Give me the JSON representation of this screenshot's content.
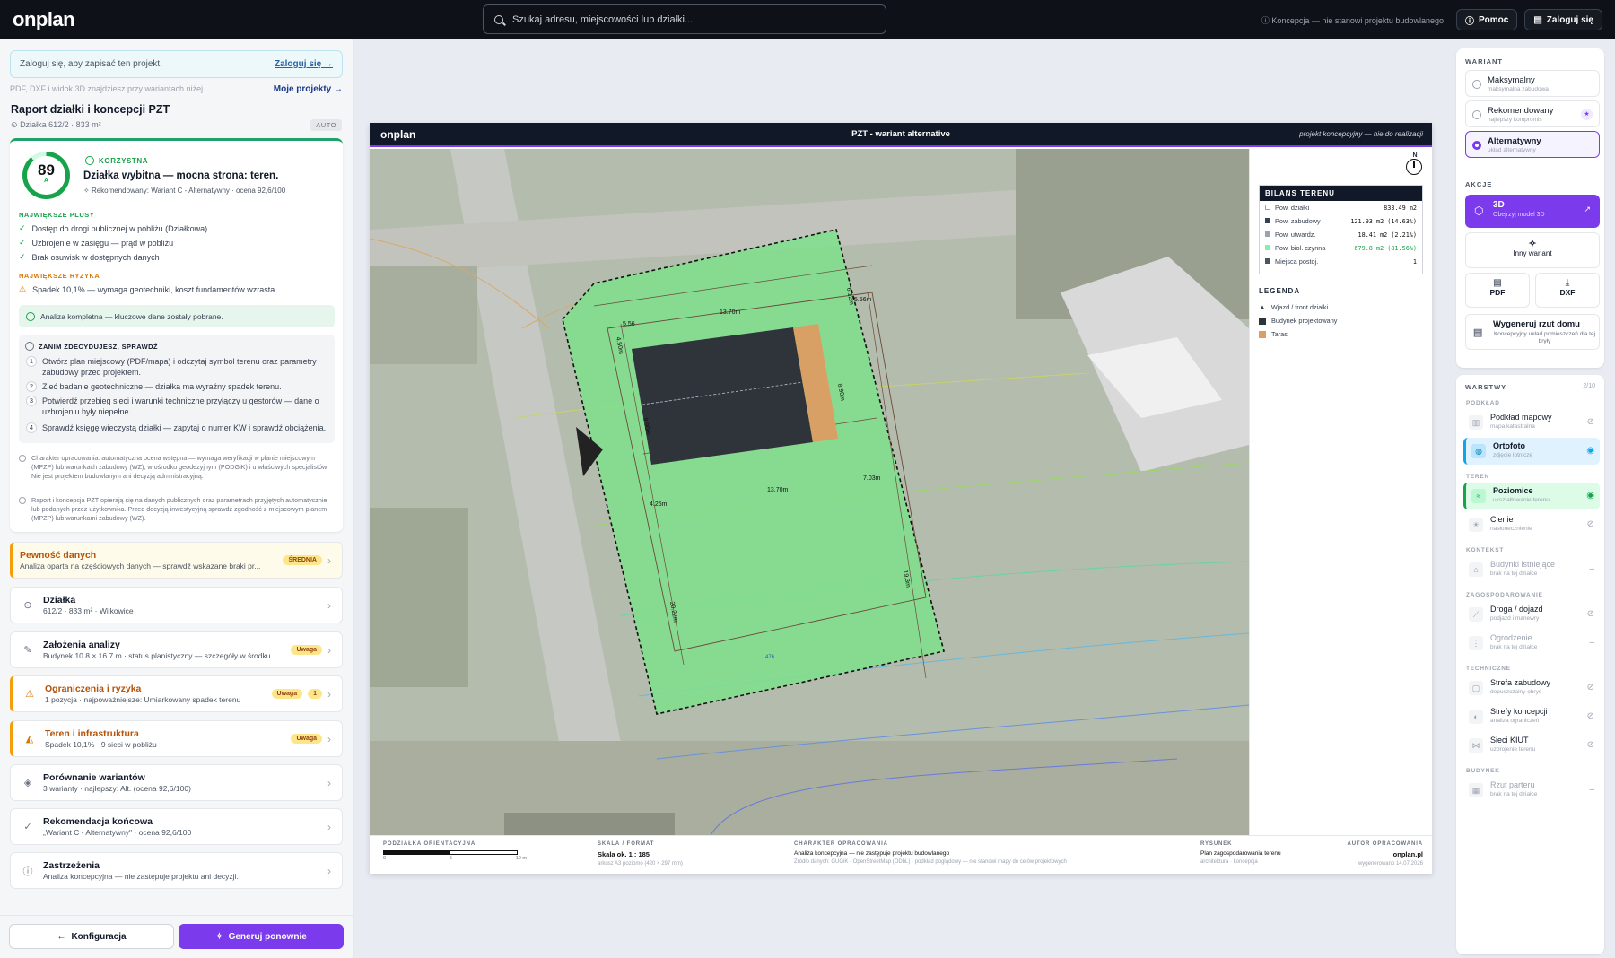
{
  "header": {
    "logo": "onplan",
    "search_placeholder": "Szukaj adresu, miejscowości lub działki...",
    "disclaimer": "Koncepcja — nie stanowi projektu budowlanego",
    "help": "Pomoc",
    "login": "Zaloguj się"
  },
  "left": {
    "login_hint": "Zaloguj się, aby zapisać ten projekt.",
    "login_link": "Zaloguj się →",
    "files_hint": "PDF, DXF i widok 3D znajdziesz przy wariantach niżej.",
    "my_projects": "Moje projekty →",
    "title": "Raport działki i koncepcji PZT",
    "plot": "Działka 612/2 · 833 m²",
    "auto": "AUTO",
    "score": "89",
    "grade": "A",
    "verdict": "KORZYSTNA",
    "headline": "Działka wybitna — mocna strona: teren.",
    "recommended": "Rekomendowany: Wariant C - Alternatywny · ocena 92,6/100",
    "plus_title": "NAJWIĘKSZE PLUSY",
    "plus": [
      "Dostęp do drogi publicznej w pobliżu (Działkowa)",
      "Uzbrojenie w zasięgu — prąd w pobliżu",
      "Brak osuwisk w dostępnych danych"
    ],
    "risk_title": "NAJWIĘKSZE RYZYKA",
    "risks": [
      "Spadek 10,1% — wymaga geotechniki, koszt fundamentów wzrasta"
    ],
    "analysis_ok": "Analiza kompletna — kluczowe dane zostały pobrane.",
    "check_title": "ZANIM ZDECYDUJESZ, SPRAWDŹ",
    "checks": [
      "Otwórz plan miejscowy (PDF/mapa) i odczytaj symbol terenu oraz parametry zabudowy przed projektem.",
      "Zleć badanie geotechniczne — działka ma wyraźny spadek terenu.",
      "Potwierdź przebieg sieci i warunki techniczne przyłączy u gestorów — dane o uzbrojeniu były niepełne.",
      "Sprawdź księgę wieczystą działki — zapytaj o numer KW i sprawdź obciążenia."
    ],
    "notes": [
      "Charakter opracowania: automatyczna ocena wstępna — wymaga weryfikacji w planie miejscowym (MPZP) lub warunkach zabudowy (WZ), w ośrodku geodezyjnym (PODGiK) i u właściwych specjalistów. Nie jest projektem budowlanym ani decyzją administracyjną.",
      "Raport i koncepcja PZT opierają się na danych publicznych oraz parametrach przyjętych automatycznie lub podanych przez użytkownika. Przed decyzją inwestycyjną sprawdź zgodność z miejscowym planem (MPZP) lub warunkami zabudowy (WZ)."
    ],
    "accordion": [
      {
        "t": "Pewność danych",
        "s": "Analiza oparta na częściowych danych — sprawdź wskazane braki pr...",
        "badge": "ŚREDNIA"
      },
      {
        "t": "Działka",
        "s": "612/2 · 833 m² · Wilkowice"
      },
      {
        "t": "Założenia analizy",
        "s": "Budynek 10.8 × 16.7 m · status planistyczny — szczegóły w środku",
        "badge": "Uwaga"
      },
      {
        "t": "Ograniczenia i ryzyka",
        "s": "1 pozycja · najpoważniejsze: Umiarkowany spadek terenu",
        "badge": "Uwaga",
        "count": "1"
      },
      {
        "t": "Teren i infrastruktura",
        "s": "Spadek 10,1% · 9 sieci w pobliżu",
        "badge": "Uwaga"
      },
      {
        "t": "Porównanie wariantów",
        "s": "3 warianty · najlepszy: Alt. (ocena 92,6/100)"
      },
      {
        "t": "Rekomendacja końcowa",
        "s": "„Wariant C - Alternatywny\" · ocena 92,6/100"
      },
      {
        "t": "Zastrzeżenia",
        "s": "Analiza koncepcyjna — nie zastępuje projektu ani decyzji."
      }
    ],
    "btn_config": "Konfiguracja",
    "btn_regen": "Generuj ponownie"
  },
  "sheet": {
    "logo": "onplan",
    "title": "PZT - wariant alternative",
    "note": "projekt koncepcyjny — nie do realizacji",
    "north": "N",
    "dims": [
      "13.70m",
      "13.70m",
      "5.56",
      "5.56m",
      "4.50m",
      "6.12m",
      "8.90m",
      "8.90m",
      "4.25m",
      "7.03m",
      "20.22m",
      "19.3m",
      "476"
    ],
    "bilans_title": "BILANS TERENU",
    "bilans": [
      {
        "k": "Pow. działki",
        "v": "833.49 m2",
        "c": "#ffffff"
      },
      {
        "k": "Pow. zabudowy",
        "v": "121.93 m2 (14.63%)",
        "c": "#374151"
      },
      {
        "k": "Pow. utwardz.",
        "v": "18.41 m2 (2.21%)",
        "c": "#9ca3af"
      },
      {
        "k": "Pow. biol. czynna",
        "v": "679.8 m2 (81.56%)",
        "c": "#86efac"
      },
      {
        "k": "Miejsca postoj.",
        "v": "1",
        "c": "#4b5563"
      }
    ],
    "legend_title": "LEGENDA",
    "legend": [
      "Wjazd / front działki",
      "Budynek projektowany",
      "Taras"
    ],
    "foot": {
      "scale_l": "PODZIAŁKA ORIENTACYJNA",
      "scale_ticks": [
        "0",
        "5",
        "10 m"
      ],
      "fmt_l": "SKALA / FORMAT",
      "fmt_v": "Skala ok. 1 : 185",
      "fmt_s": "arkusz A3 poziomo (420 × 297 mm)",
      "ch_l": "CHARAKTER OPRACOWANIA",
      "ch_v": "Analiza koncepcyjna — nie zastępuje projektu budowlanego",
      "ch_s": "Źródło danych: GUGiK · OpenStreetMap (ODbL) · podkład poglądowy — nie stanowi mapy do celów projektowych",
      "rys_l": "RYSUNEK",
      "rys_v": "Plan zagospodarowania terenu",
      "rys_s": "architektura · koncepcja",
      "aut_l": "AUTOR OPRACOWANIA",
      "aut_v": "onplan.pl",
      "aut_s": "wygenerowano 14.07.2026"
    }
  },
  "right": {
    "variant_title": "WARIANT",
    "variants": [
      {
        "a": "Maksymalny",
        "b": "maksymalna zabudowa"
      },
      {
        "a": "Rekomendowany",
        "b": "najlepszy kompromis"
      },
      {
        "a": "Alternatywny",
        "b": "układ alternatywny"
      }
    ],
    "actions_title": "AKCJE",
    "btn3d": "3D",
    "btn3d_sub": "Obejrzyj model 3D",
    "other": "Inny wariant",
    "pdf": "PDF",
    "dxf": "DXF",
    "plan_btn": "Wygeneruj rzut domu",
    "plan_sub": "Koncepcyjny układ pomieszczeń dla tej bryły",
    "layers_title": "WARSTWY",
    "layers_count": "2/10",
    "groups": [
      "PODKŁAD",
      "TEREN",
      "KONTEKST",
      "ZAGOSPODAROWANIE",
      "TECHNICZNE",
      "BUDYNEK"
    ],
    "layers": [
      {
        "a": "Podkład mapowy",
        "b": "mapa katastralna"
      },
      {
        "a": "Ortofoto",
        "b": "zdjęcie lotnicze"
      },
      {
        "a": "Poziomice",
        "b": "ukształtowanie terenu"
      },
      {
        "a": "Cienie",
        "b": "nasłonecznienie"
      },
      {
        "a": "Budynki istniejące",
        "b": "brak na tej działce"
      },
      {
        "a": "Droga / dojazd",
        "b": "podjazd i manewry"
      },
      {
        "a": "Ogrodzenie",
        "b": "brak na tej działce"
      },
      {
        "a": "Strefa zabudowy",
        "b": "dopuszczalny obrys"
      },
      {
        "a": "Strefy koncepcji",
        "b": "analiza ograniczeń"
      },
      {
        "a": "Sieci KIUT",
        "b": "uzbrojenie terenu"
      },
      {
        "a": "Rzut parteru",
        "b": "brak na tej działce"
      }
    ]
  }
}
